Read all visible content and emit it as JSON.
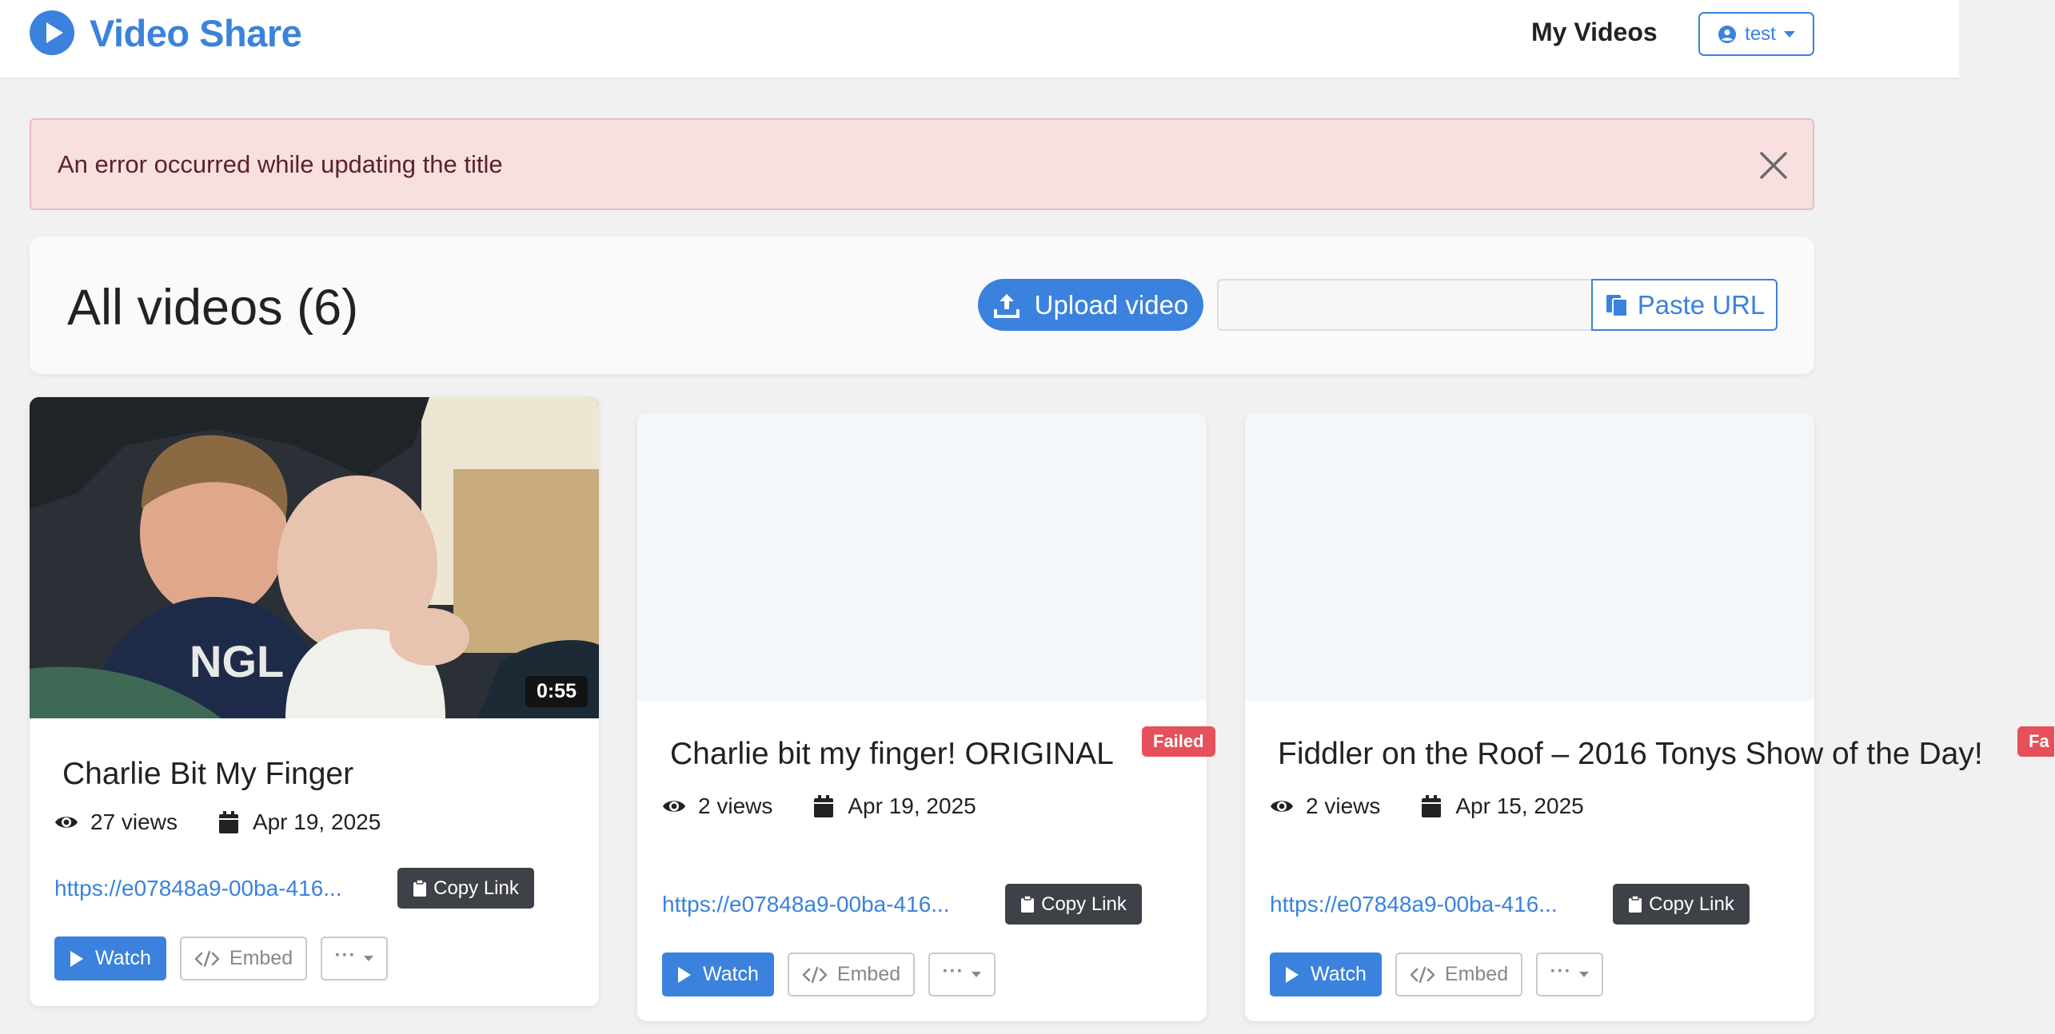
{
  "header": {
    "brand": "Video Share",
    "nav_link": "My Videos",
    "user_label": "test"
  },
  "alert": {
    "message": "An error occurred while updating the title"
  },
  "toolbar": {
    "title": "All videos (6)",
    "upload_label": "Upload video",
    "url_value": "",
    "paste_label": "Paste URL"
  },
  "videos": [
    {
      "title": "Charlie Bit My Finger",
      "duration": "0:55",
      "views": "27 views",
      "date": "Apr 19, 2025",
      "link": "https://e07848a9-00ba-416...",
      "copy_label": "Copy Link",
      "watch_label": "Watch",
      "embed_label": "Embed",
      "status": ""
    },
    {
      "title": "Charlie bit my finger! ORIGINAL",
      "duration": "",
      "views": "2 views",
      "date": "Apr 19, 2025",
      "link": "https://e07848a9-00ba-416...",
      "copy_label": "Copy Link",
      "watch_label": "Watch",
      "embed_label": "Embed",
      "status": "Failed"
    },
    {
      "title": "Fiddler on the Roof – 2016 Tonys Show of the Day!",
      "duration": "",
      "views": "2 views",
      "date": "Apr 15, 2025",
      "link": "https://e07848a9-00ba-416...",
      "copy_label": "Copy Link",
      "watch_label": "Watch",
      "embed_label": "Embed",
      "status": "Fa"
    }
  ],
  "icons": {
    "brand": "play-circle-icon",
    "user": "user-circle-icon",
    "close": "close-icon",
    "upload": "upload-icon",
    "paste": "clipboard-icon",
    "views": "eye-icon",
    "date": "calendar-icon",
    "copy": "clipboard-icon",
    "watch": "play-icon",
    "embed": "code-icon",
    "more": "ellipsis-icon"
  },
  "colors": {
    "accent": "#3a82dd",
    "alert_bg": "#f8dfe0",
    "alert_text": "#5b2326",
    "failed_badge": "#e5505a",
    "dark_button": "#3f4148"
  }
}
